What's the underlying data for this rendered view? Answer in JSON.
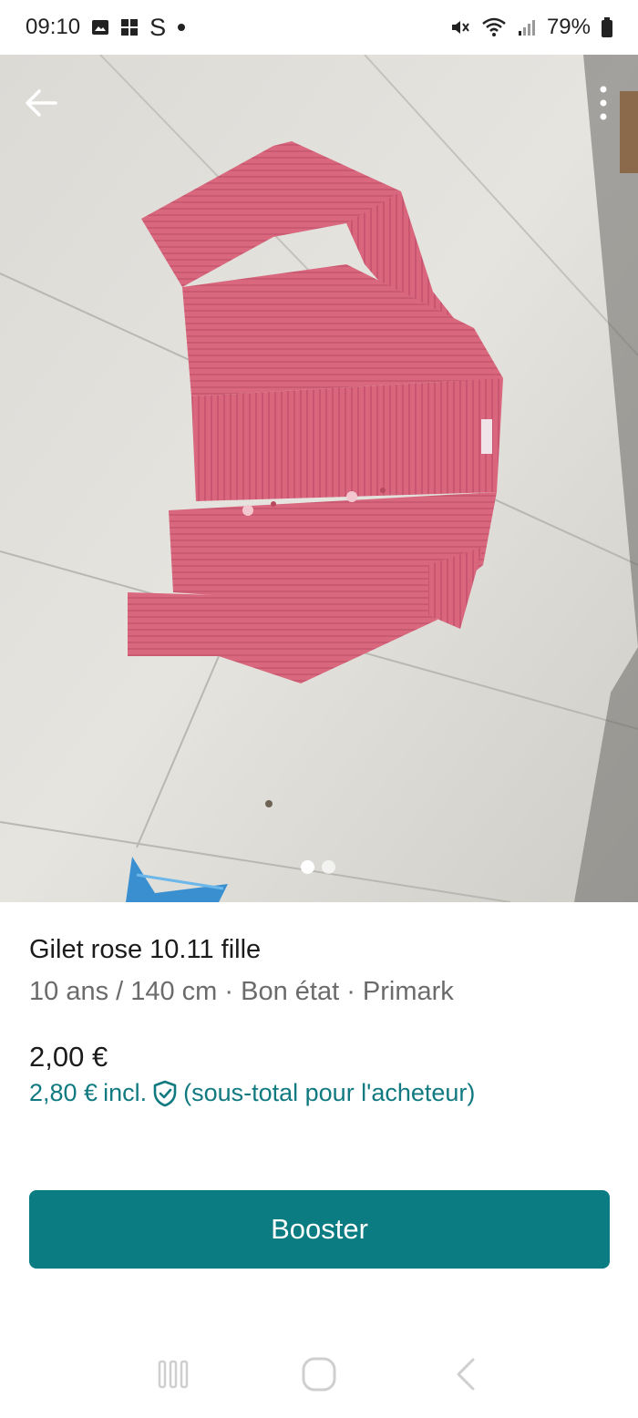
{
  "status_bar": {
    "time": "09:10",
    "carrier_glyph": "S",
    "battery": "79%",
    "icons": [
      "gallery-icon",
      "grid-app-icon",
      "mute-icon",
      "wifi-icon",
      "signal-icon",
      "battery-icon"
    ]
  },
  "toolbar": {
    "back_icon": "arrow-left-icon",
    "menu_icon": "more-vertical-icon"
  },
  "carousel": {
    "image_count": 2,
    "active_index": 0
  },
  "item": {
    "title": "Gilet rose 10.11 fille",
    "meta": "10 ans / 140 cm · Bon état · Primark",
    "price": "2,00 €",
    "price_incl_amount": "2,80 €",
    "price_incl_label": "incl.",
    "price_incl_note": "(sous-total pour l'acheteur)"
  },
  "actions": {
    "boost_label": "Booster"
  },
  "nav": {
    "icons": [
      "recent-apps-icon",
      "home-icon",
      "back-chevron-icon"
    ]
  },
  "colors": {
    "accent": "#0b7c82",
    "accent_text": "#117a80",
    "garment": "#d9647a"
  }
}
